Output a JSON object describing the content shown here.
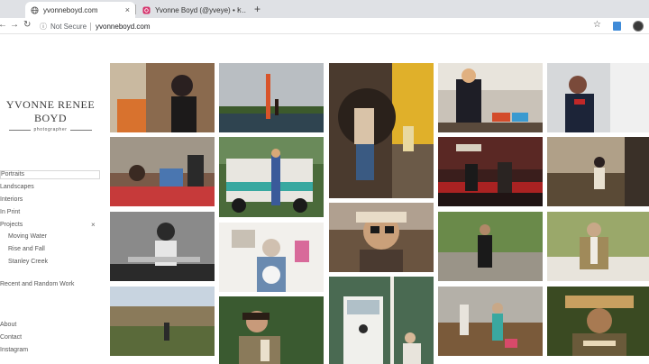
{
  "browser": {
    "tabs": [
      {
        "title": "yvonneboyd.com",
        "active": true,
        "icon": "globe-icon"
      },
      {
        "title": "Yvonne Boyd (@yveye) • Instagr",
        "active": false,
        "icon": "instagram-icon"
      }
    ],
    "new_tab_label": "+",
    "close_glyph": "×",
    "security_label": "Not Secure",
    "url": "yvonneboyd.com"
  },
  "site": {
    "logo_name": "YVONNE RENEE BOYD",
    "logo_subtitle": "photographer",
    "menu": {
      "portraits": "Portraits",
      "landscapes": "Landscapes",
      "interiors": "Interiors",
      "in_print": "In Print",
      "projects": "Projects",
      "projects_close": "×",
      "project_items": [
        "Moving Water",
        "Rise and Fall",
        "Stanley Creek"
      ],
      "recent_work": "Recent and Random Work",
      "about": "About",
      "contact": "Contact",
      "instagram": "Instagram"
    }
  },
  "gallery": {
    "photos": [
      {
        "alt": "woman with harp"
      },
      {
        "alt": "paddleboard on lake"
      },
      {
        "alt": "woman in wicker chair"
      },
      {
        "alt": "chef in kitchen"
      },
      {
        "alt": "woman in uniform"
      },
      {
        "alt": "woman at table with radio"
      },
      {
        "alt": "woman with vintage trailer"
      },
      {
        "alt": "couple on checkered floor"
      },
      {
        "alt": "person sitting on floor"
      },
      {
        "alt": "man in black and white"
      },
      {
        "alt": "woman in cowboy hat"
      },
      {
        "alt": "older woman with dog"
      },
      {
        "alt": "woman in garden"
      },
      {
        "alt": "man in green room"
      },
      {
        "alt": "desert landscape"
      },
      {
        "alt": "young man outdoors"
      },
      {
        "alt": "green door"
      },
      {
        "alt": "garden figures"
      },
      {
        "alt": "man in straw hat"
      }
    ]
  }
}
